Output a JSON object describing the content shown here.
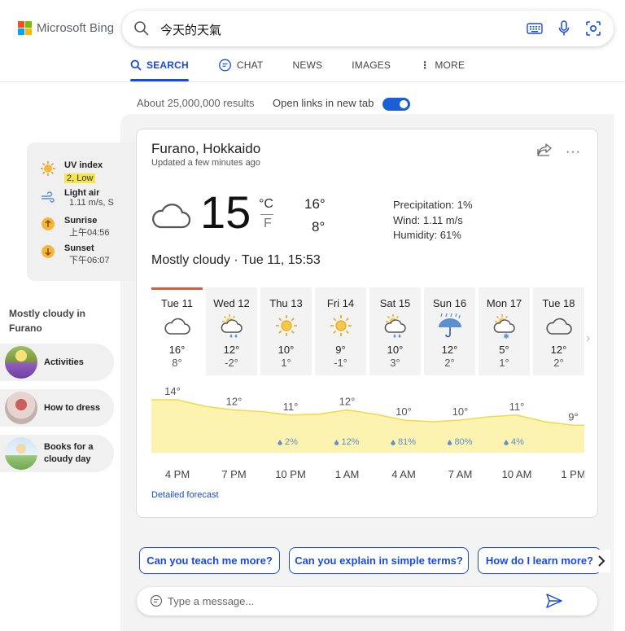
{
  "header": {
    "brand": "Microsoft Bing",
    "brand_colors": [
      "#f25022",
      "#7fba00",
      "#00a4ef",
      "#ffb900"
    ],
    "search_query": "今天的天氣",
    "icons": [
      "search-icon",
      "keyboard-icon",
      "microphone-icon",
      "visual-search-icon"
    ]
  },
  "nav": {
    "items": [
      {
        "label": "SEARCH",
        "active": true
      },
      {
        "label": "CHAT",
        "active": false
      },
      {
        "label": "NEWS",
        "active": false
      },
      {
        "label": "IMAGES",
        "active": false
      },
      {
        "label": "MORE",
        "active": false
      }
    ]
  },
  "results": {
    "count_text": "About 25,000,000 results",
    "open_links_label": "Open links in new tab",
    "open_links_on": true
  },
  "mini_panel": {
    "uv": {
      "title": "UV index",
      "value": "2, Low"
    },
    "wind": {
      "title": "Light air",
      "value": "1.11 m/s, S"
    },
    "sunrise": {
      "title": "Sunrise",
      "value": "上午04:56"
    },
    "sunset": {
      "title": "Sunset",
      "value": "下午06:07"
    }
  },
  "side": {
    "header": "Mostly cloudy in Furano",
    "pills": [
      {
        "label": "Activities"
      },
      {
        "label": "How to dress"
      },
      {
        "label": "Books for a cloudy day"
      }
    ]
  },
  "weather": {
    "location": "Furano, Hokkaido",
    "updated": "Updated a few minutes ago",
    "current_temp": "15",
    "unit_c": "°C",
    "unit_f": "F",
    "high": "16°",
    "low": "8°",
    "precipitation": "Precipitation: 1%",
    "wind": "Wind: 1.11 m/s",
    "humidity": "Humidity: 61%",
    "condition": "Mostly cloudy · Tue 11, 15:53",
    "days": [
      {
        "name": "Tue 11",
        "hi": "16°",
        "lo": "8°",
        "icon": "cloud-icon",
        "selected": true
      },
      {
        "name": "Wed 12",
        "hi": "12°",
        "lo": "-2°",
        "icon": "sun-cloud-rain-icon",
        "selected": false
      },
      {
        "name": "Thu 13",
        "hi": "10°",
        "lo": "1°",
        "icon": "sun-icon",
        "selected": false
      },
      {
        "name": "Fri 14",
        "hi": "9°",
        "lo": "-1°",
        "icon": "sun-icon",
        "selected": false
      },
      {
        "name": "Sat 15",
        "hi": "10°",
        "lo": "3°",
        "icon": "sun-cloud-rain-icon",
        "selected": false
      },
      {
        "name": "Sun 16",
        "hi": "12°",
        "lo": "2°",
        "icon": "umbrella-rain-icon",
        "selected": false
      },
      {
        "name": "Mon 17",
        "hi": "5°",
        "lo": "1°",
        "icon": "sun-cloud-snow-icon",
        "selected": false
      },
      {
        "name": "Tue 18",
        "hi": "12°",
        "lo": "2°",
        "icon": "cloud-icon",
        "selected": false
      }
    ],
    "detailed_link": "Detailed forecast"
  },
  "chart_data": {
    "type": "area",
    "x": [
      "4 PM",
      "7 PM",
      "10 PM",
      "1 AM",
      "4 AM",
      "7 AM",
      "10 AM",
      "1 PM"
    ],
    "temp_labels": [
      "14°",
      "12°",
      "11°",
      "12°",
      "10°",
      "10°",
      "11°",
      "9°"
    ],
    "values": [
      14,
      12,
      11,
      12,
      10,
      10,
      11,
      9
    ],
    "precip_labels": [
      "",
      "",
      "2%",
      "12%",
      "81%",
      "80%",
      "4%",
      ""
    ],
    "fill_color": "#fdf3b0",
    "line_color": "#f3d84a",
    "drop_color": "#5b8fd1"
  },
  "suggestions": [
    "Can you teach me more?",
    "Can you explain in simple terms?",
    "How do I learn more?"
  ],
  "message_placeholder": "Type a message...",
  "colors": {
    "accent": "#174ae4",
    "selected_day": "#e2583e",
    "uv_highlight": "#f6e64e"
  }
}
